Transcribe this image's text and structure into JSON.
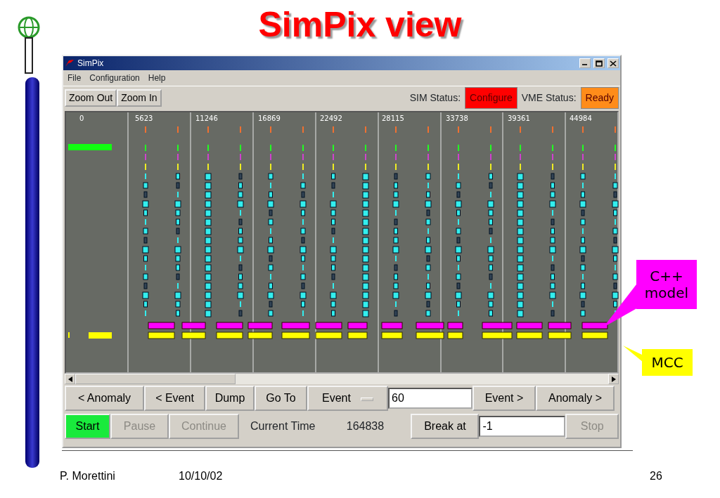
{
  "slide": {
    "title": "SimPix view"
  },
  "window": {
    "title": "SimPix"
  },
  "menu": [
    {
      "label": "File"
    },
    {
      "label": "Configuration"
    },
    {
      "label": "Help"
    }
  ],
  "toolbar": {
    "buttons": [
      "Zoom Out",
      "Zoom In"
    ],
    "statuses": [
      {
        "label": "SIM Status:",
        "value": "Configure",
        "color": "#ff0000"
      },
      {
        "label": "VME Status:",
        "value": "Ready",
        "color": "#ff8c1a"
      }
    ]
  },
  "timeline": {
    "labels": [
      "0",
      "5623",
      "11246",
      "16869",
      "22492",
      "28115",
      "33738",
      "39361",
      "44984"
    ]
  },
  "navigation": {
    "back_buttons": [
      "< Anomaly",
      "< Event",
      "Dump",
      "Go To"
    ],
    "mode": "Event",
    "event_field": {
      "value": "60"
    },
    "forward_buttons": [
      "Event >",
      "Anomaly >"
    ]
  },
  "run_controls": [
    {
      "label": "Start",
      "active": true,
      "disabled": false
    },
    {
      "label": "Pause",
      "active": false,
      "disabled": true
    },
    {
      "label": "Continue",
      "active": false,
      "disabled": true
    }
  ],
  "current_time": {
    "label": "Current Time",
    "value": "164838"
  },
  "break_at": {
    "button": "Break at",
    "value": "-1"
  },
  "stop": {
    "label": "Stop",
    "disabled": true
  },
  "callouts": [
    {
      "text": "C++ model",
      "kind": "magenta"
    },
    {
      "text": "MCC",
      "kind": "yellow"
    }
  ],
  "footer": {
    "author": "P. Morettini",
    "date": "10/10/02",
    "page": "26"
  }
}
